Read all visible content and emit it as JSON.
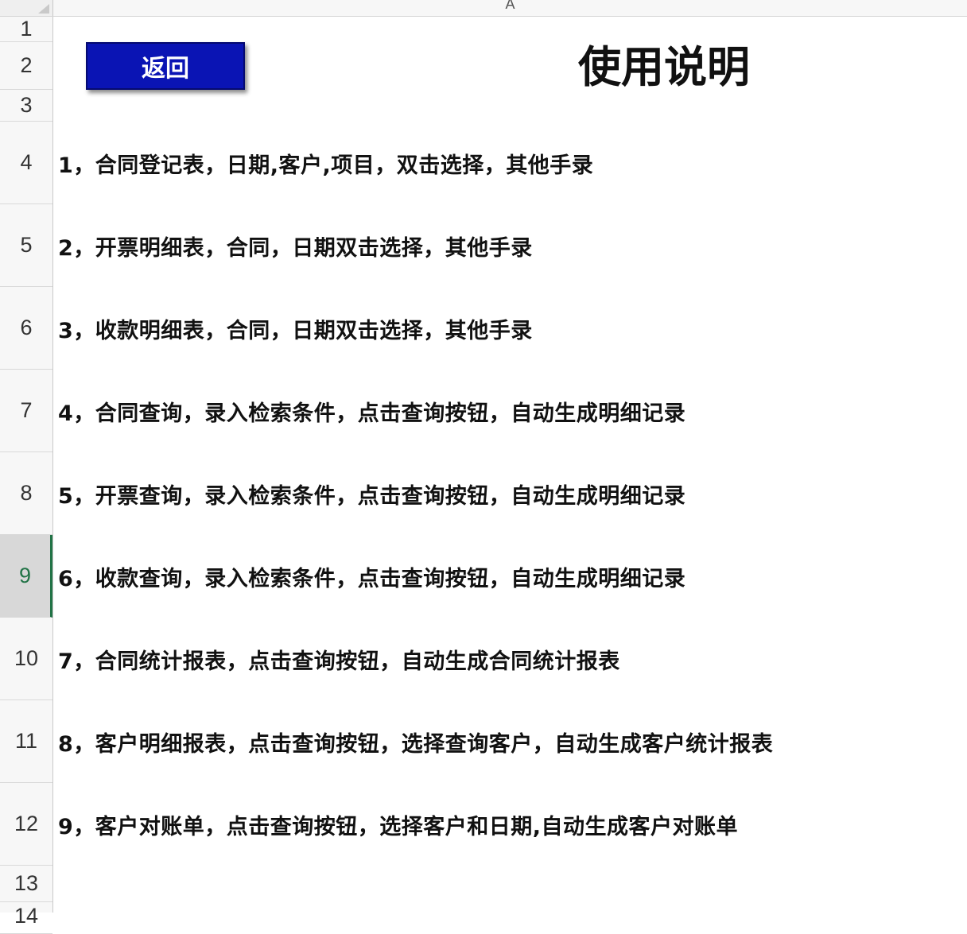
{
  "header": {
    "column_label": "A"
  },
  "row_numbers": [
    "1",
    "2",
    "3",
    "4",
    "5",
    "6",
    "7",
    "8",
    "9",
    "10",
    "11",
    "12",
    "13",
    "14"
  ],
  "active_row": "9",
  "back_button": {
    "label": "返回",
    "color": "#0a14b4"
  },
  "title": "使用说明",
  "instructions": [
    "1，合同登记表，日期,客户,项目，双击选择，其他手录",
    "2，开票明细表，合同，日期双击选择，其他手录",
    "3，收款明细表，合同，日期双击选择，其他手录",
    "4，合同查询，录入检索条件，点击查询按钮，自动生成明细记录",
    "5，开票查询，录入检索条件，点击查询按钮，自动生成明细记录",
    "6，收款查询，录入检索条件，点击查询按钮，自动生成明细记录",
    "7，合同统计报表，点击查询按钮，自动生成合同统计报表",
    "8，客户明细报表，点击查询按钮，选择查询客户，自动生成客户统计报表",
    "9，客户对账单，点击查询按钮，选择客户和日期,自动生成客户对账单"
  ]
}
